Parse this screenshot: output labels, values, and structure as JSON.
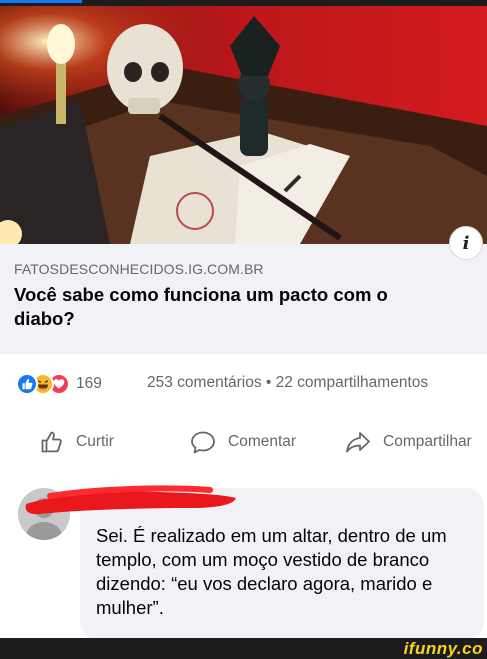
{
  "link_preview": {
    "domain": "FATOSDESCONHECIDOS.IG.COM.BR",
    "title": "Você sabe como funciona um pacto com o diabo?",
    "info_glyph": "i"
  },
  "reactions": {
    "types": [
      "like-icon",
      "haha-icon",
      "love-icon"
    ],
    "count": "169"
  },
  "stats": {
    "summary": "253 comentários • 22 compartilhamentos"
  },
  "actions": {
    "like_label": "Curtir",
    "comment_label": "Comentar",
    "share_label": "Compartilhar"
  },
  "comment": {
    "text": "Sei. É realizado em um altar, dentro de um templo, com um moço vestido de branco dizendo: “eu vos declaro agora, marido e mulher”."
  },
  "watermark": {
    "text": "ifunny.co"
  },
  "colors": {
    "facebook_blue": "#1877f2",
    "haha_yellow": "#f7b928",
    "love_red": "#f33e58",
    "secondary_text": "#65676b",
    "bubble_bg": "#f0f2f5",
    "ifunny_yellow": "#f8d21c"
  }
}
